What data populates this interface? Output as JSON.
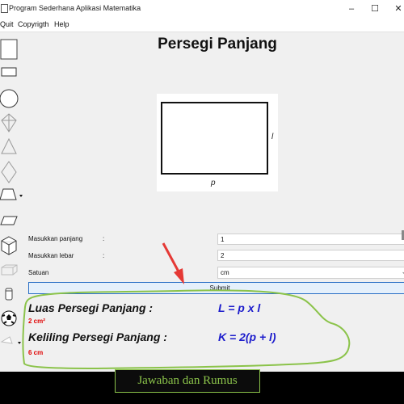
{
  "window": {
    "title": "Program Sederhana Aplikasi Matematika",
    "minimize": "–",
    "maximize": "☐",
    "close": "✕"
  },
  "menu": [
    "Quit",
    "Copyrigth",
    "Help"
  ],
  "toolbar": {
    "tools": [
      "square-icon",
      "rectangle-icon",
      "circle-icon",
      "kite-icon",
      "triangle-icon",
      "rhombus-icon",
      "trapezoid-icon",
      "parallelogram-icon",
      "cube-icon",
      "cuboid-icon",
      "cylinder-icon",
      "sphere-icon",
      "cone-icon"
    ]
  },
  "main": {
    "title": "Persegi Panjang",
    "figure": {
      "side_label": "l",
      "bottom_label": "p"
    },
    "fields": {
      "length_label": "Masukkan panjang",
      "width_label": "Masukkan lebar",
      "unit_label": "Satuan",
      "colon": ":",
      "length_value": "1",
      "width_value": "2",
      "unit_value": "cm"
    },
    "submit_label": "Submit",
    "results": {
      "area_title": "Luas Persegi Panjang :",
      "area_formula": "L = p x l",
      "area_value": "2 cm²",
      "perimeter_title": "Keliling Persegi Panjang :",
      "perimeter_formula": "K = 2(p + l)",
      "perimeter_value": "6 cm"
    }
  },
  "annotation": {
    "caption": "Jawaban dan Rumus",
    "outline_color": "#8bc34a",
    "arrow_color": "#e53935"
  }
}
